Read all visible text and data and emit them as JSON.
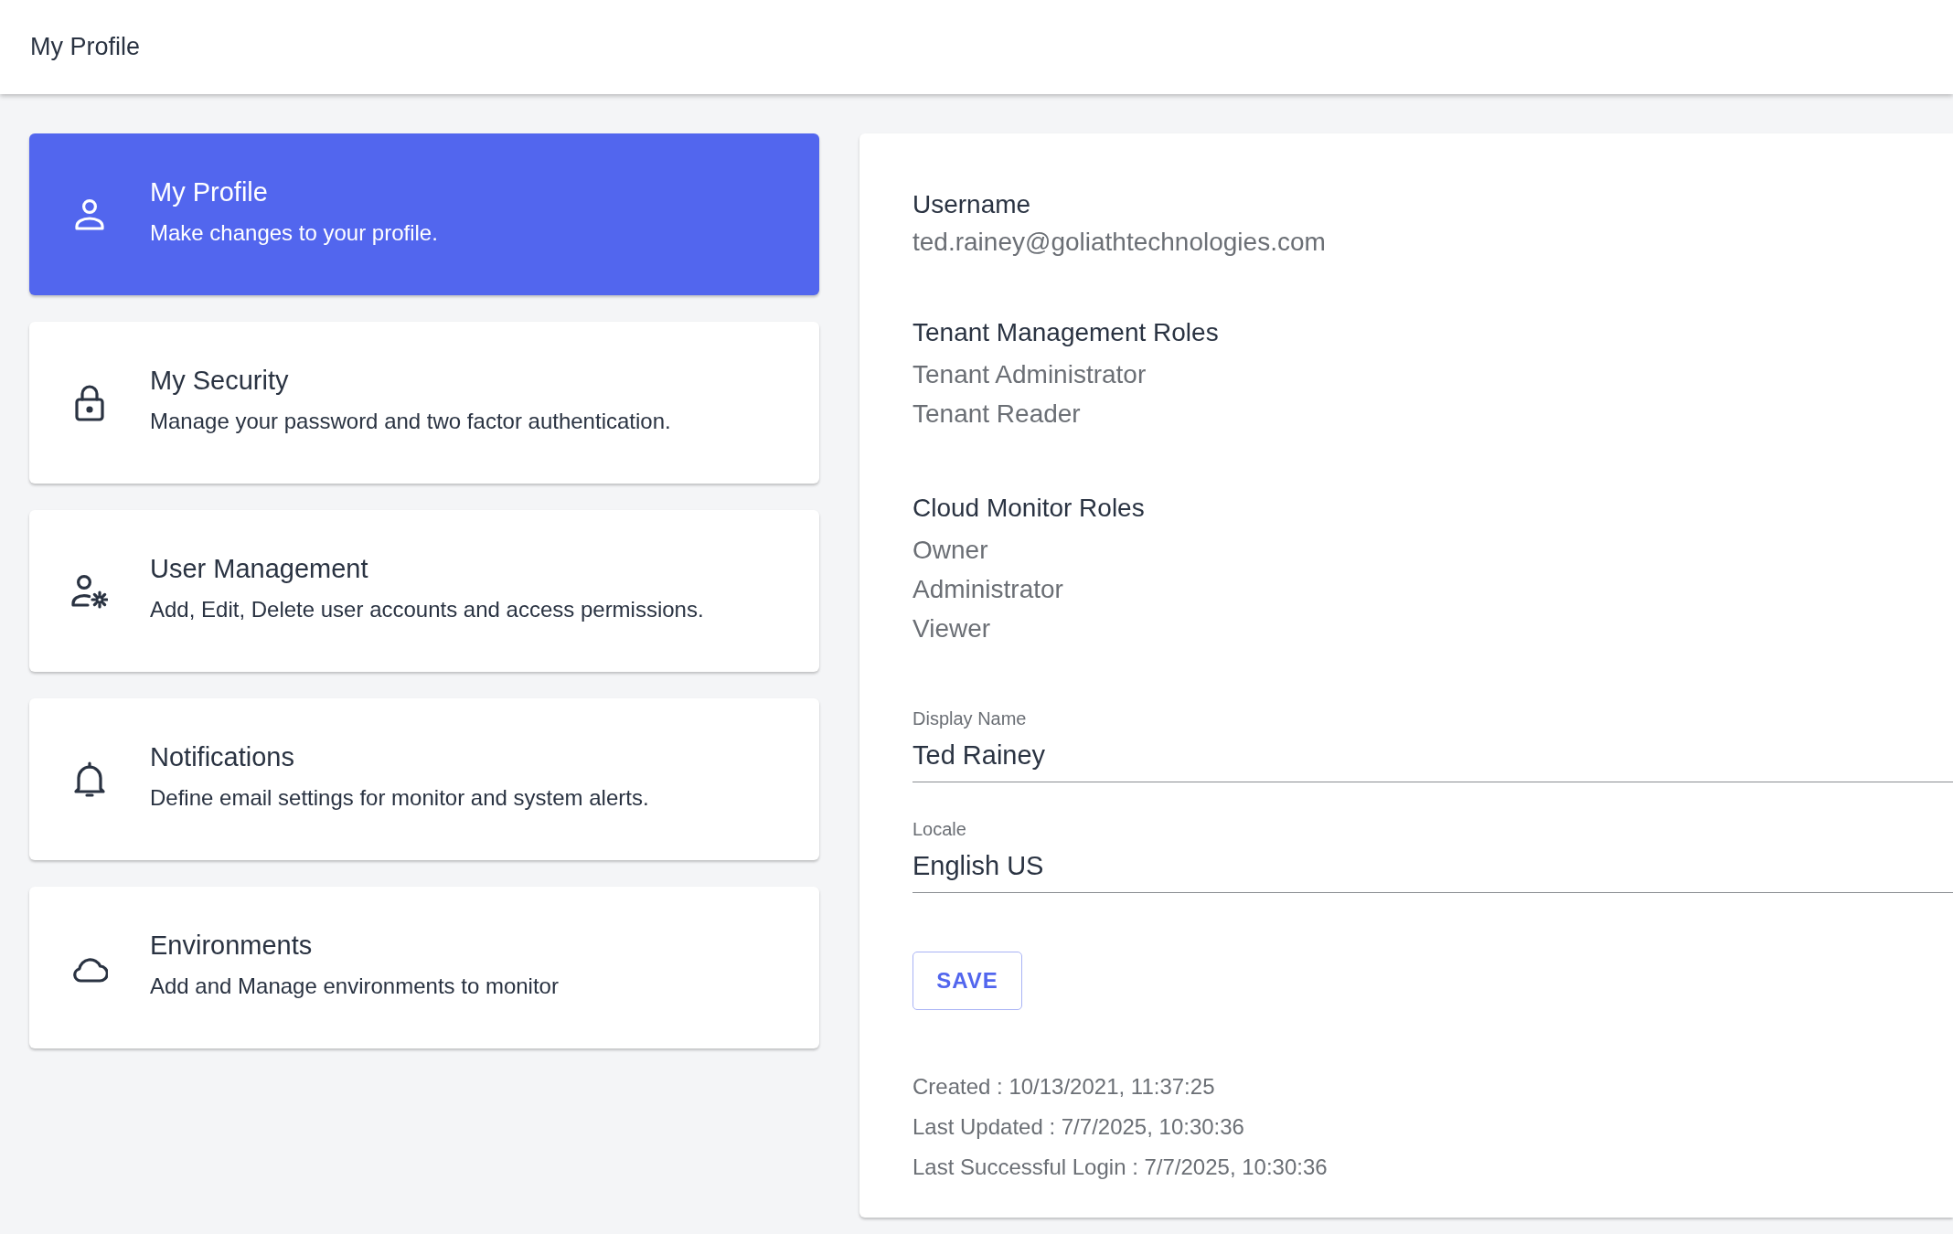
{
  "header": {
    "title": "My Profile"
  },
  "menu": [
    {
      "kind": "person",
      "title": "My Profile",
      "description": "Make changes to your profile.",
      "selected": true
    },
    {
      "kind": "lock",
      "title": "My Security",
      "description": "Manage your password and two factor authentication.",
      "selected": false
    },
    {
      "kind": "user-gear",
      "title": "User Management",
      "description": "Add, Edit, Delete user accounts and access permissions.",
      "selected": false
    },
    {
      "kind": "bell",
      "title": "Notifications",
      "description": "Define email settings for monitor and system alerts.",
      "selected": false
    },
    {
      "kind": "cloud",
      "title": "Environments",
      "description": "Add and Manage environments to monitor",
      "selected": false
    }
  ],
  "profile": {
    "sections": [
      {
        "label": "Username",
        "values": [
          "ted.rainey@goliathtechnologies.com"
        ]
      },
      {
        "label": "Tenant Management Roles",
        "values": [
          "Tenant Administrator",
          "Tenant Reader"
        ]
      },
      {
        "label": "Cloud Monitor Roles",
        "values": [
          "Owner",
          "Administrator",
          "Viewer"
        ]
      }
    ],
    "fields": [
      {
        "label": "Display Name",
        "value": "Ted Rainey"
      },
      {
        "label": "Locale",
        "value": "English US"
      }
    ],
    "save_button": "SAVE",
    "meta": [
      "Created : 10/13/2021, 11:37:25",
      "Last Updated : 7/7/2025, 10:30:36",
      "Last Successful Login : 7/7/2025, 10:30:36"
    ]
  }
}
